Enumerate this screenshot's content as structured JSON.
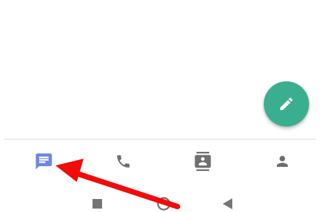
{
  "colors": {
    "fab_background": "#3aaf8f",
    "active_tab": "#6a86e8",
    "inactive_tab": "#6f6f6f",
    "system_button": "#757575",
    "annotation_arrow": "#f20b0b"
  },
  "fab": {
    "icon": "pencil-icon"
  },
  "bottom_nav": {
    "active_tab": "messages",
    "tabs": [
      {
        "id": "messages",
        "icon": "message-icon"
      },
      {
        "id": "calls",
        "icon": "phone-icon"
      },
      {
        "id": "contacts",
        "icon": "contacts-icon"
      },
      {
        "id": "profile",
        "icon": "person-icon"
      }
    ]
  },
  "system_nav": {
    "buttons": [
      {
        "id": "recents",
        "icon": "square-icon"
      },
      {
        "id": "home",
        "icon": "circle-icon"
      },
      {
        "id": "back",
        "icon": "back-triangle-icon"
      }
    ]
  },
  "annotation": {
    "type": "arrow",
    "color": "#f20b0b",
    "points_to": "messages"
  }
}
